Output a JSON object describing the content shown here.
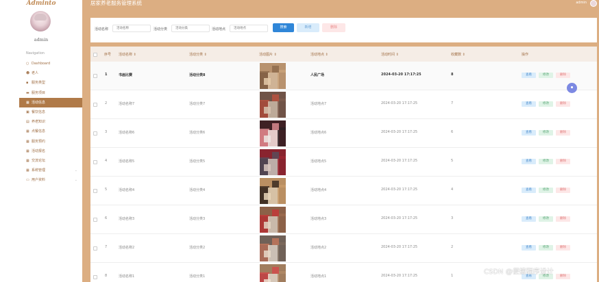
{
  "app": {
    "logo": "Adminto",
    "title": "居家养老服务管理系统",
    "user": "admin"
  },
  "sidebar": {
    "admin_name": "admin",
    "nav_header": "Navigation",
    "items": [
      {
        "label": "Dashboard",
        "icon": "○",
        "active": false
      },
      {
        "label": "老人",
        "icon": "☻",
        "active": false
      },
      {
        "label": "服务类型",
        "icon": "▪",
        "active": false
      },
      {
        "label": "服务项目",
        "icon": "▬",
        "active": false
      },
      {
        "label": "活动信息",
        "icon": "▦",
        "active": true
      },
      {
        "label": "餐饮信息",
        "icon": "▣",
        "active": false
      },
      {
        "label": "养老知识",
        "icon": "▤",
        "active": false
      },
      {
        "label": "点餐信息",
        "icon": "▦",
        "active": false
      },
      {
        "label": "服务预约",
        "icon": "▦",
        "active": false
      },
      {
        "label": "活动报名",
        "icon": "▦",
        "active": false
      },
      {
        "label": "交流论坛",
        "icon": "▦",
        "active": false
      },
      {
        "label": "系统管理",
        "icon": "▦",
        "active": false,
        "chevron": "⌄"
      },
      {
        "label": "用户资料",
        "icon": "▭",
        "active": false,
        "chevron": "⌄"
      }
    ]
  },
  "search": {
    "fields": [
      {
        "label": "活动名称",
        "placeholder": "活动名称"
      },
      {
        "label": "活动分类",
        "placeholder": "活动分类"
      },
      {
        "label": "活动地点",
        "placeholder": "活动地点"
      }
    ],
    "buttons": {
      "search": "搜索",
      "add": "新增",
      "delete": "删除"
    }
  },
  "table": {
    "columns": [
      "序号",
      "活动名称 ⇕",
      "活动分类 ⇕",
      "活动图片 ⇕",
      "活动地点 ⇕",
      "活动时间 ⇕",
      "收藏数 ⇕",
      "操作"
    ],
    "actions": {
      "view": "查看",
      "edit": "修改",
      "delete": "删除"
    },
    "rows": [
      {
        "index": "1",
        "name": "书画比赛",
        "category": "活动分类8",
        "location": "人民广场",
        "time": "2024-03-20 17:17:25",
        "favorites": "8"
      },
      {
        "index": "2",
        "name": "活动名称7",
        "category": "活动分类7",
        "location": "活动地点7",
        "time": "2024-03-20 17:17:25",
        "favorites": "7"
      },
      {
        "index": "3",
        "name": "活动名称6",
        "category": "活动分类6",
        "location": "活动地点6",
        "time": "2024-03-20 17:17:25",
        "favorites": "6"
      },
      {
        "index": "4",
        "name": "活动名称5",
        "category": "活动分类5",
        "location": "活动地点5",
        "time": "2024-03-20 17:17:25",
        "favorites": "5"
      },
      {
        "index": "5",
        "name": "活动名称4",
        "category": "活动分类4",
        "location": "活动地点4",
        "time": "2024-03-20 17:17:25",
        "favorites": "4"
      },
      {
        "index": "6",
        "name": "活动名称3",
        "category": "活动分类3",
        "location": "活动地点3",
        "time": "2024-03-20 17:17:25",
        "favorites": "3"
      },
      {
        "index": "7",
        "name": "活动名称2",
        "category": "活动分类2",
        "location": "活动地点2",
        "time": "2024-03-20 17:17:25",
        "favorites": "2"
      },
      {
        "index": "8",
        "name": "活动名称1",
        "category": "活动分类1",
        "location": "活动地点1",
        "time": "2024-03-20 17:17:25",
        "favorites": "1"
      }
    ]
  },
  "watermark": "CSDN @便捷程序设计",
  "colors": {
    "sidebar_active": "#b07a48",
    "main_bg": "#dcae82",
    "primary": "#2f86d8"
  }
}
